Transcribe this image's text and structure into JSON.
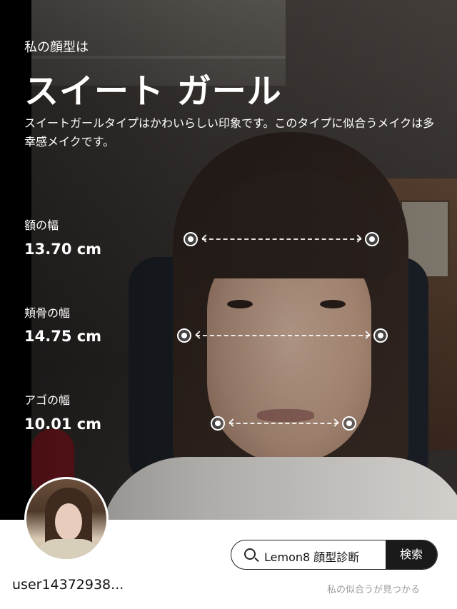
{
  "header": {
    "subtitle": "私の顔型は",
    "title": "スイート ガール",
    "description": "スイートガールタイプはかわいらしい印象です。このタイプに似合うメイクは多幸感メイクです。"
  },
  "metrics": [
    {
      "label": "額の幅",
      "value": "13.70 cm"
    },
    {
      "label": "頬骨の幅",
      "value": "14.75 cm"
    },
    {
      "label": "アゴの幅",
      "value": "10.01 cm"
    }
  ],
  "footer": {
    "username": "user14372938...",
    "search_text": "Lemon8 顔型診断",
    "search_button": "検索",
    "tagline": "私の似合うが見つかる"
  },
  "icons": {
    "search": "search-icon",
    "measure_endpoint": "dot-icon"
  },
  "colors": {
    "text_on_photo": "#ffffff",
    "search_button_bg": "#1a1a1a",
    "tagline": "#9a9a9a"
  }
}
